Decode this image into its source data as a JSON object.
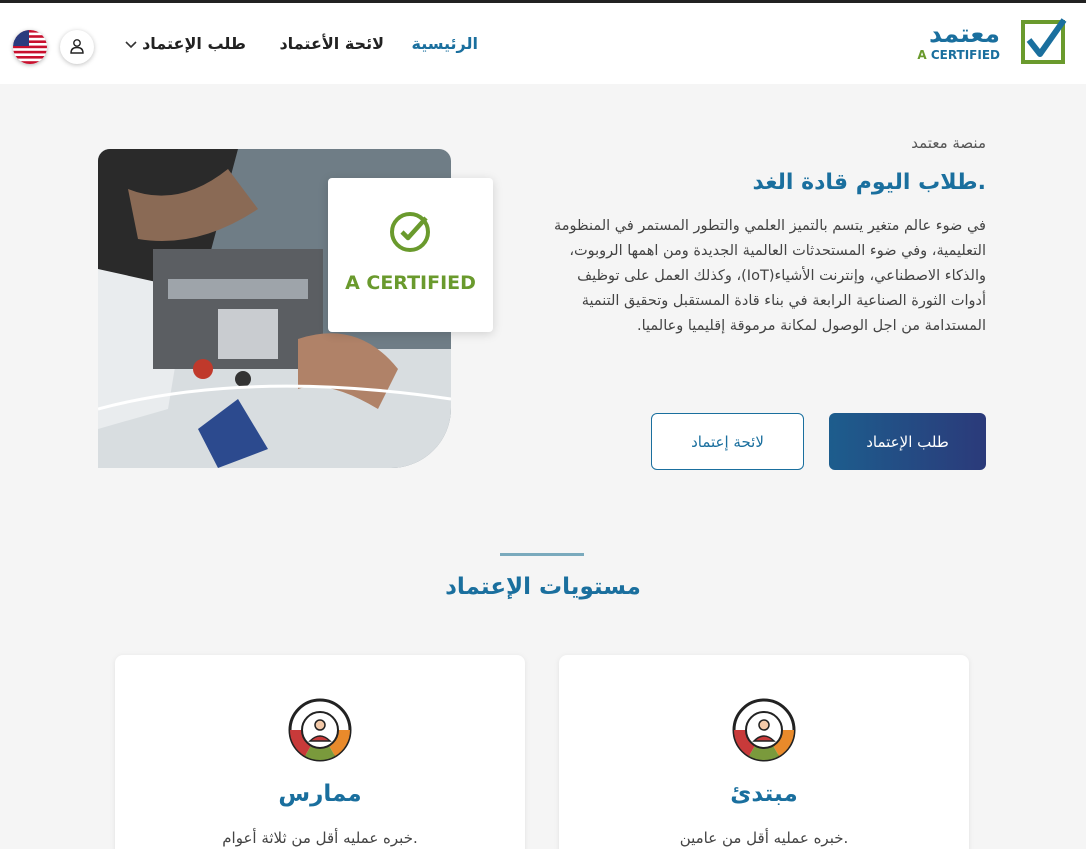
{
  "brand": {
    "logo_arabic": "معتمد",
    "logo_a": "A",
    "logo_certified": "CERTIFIED"
  },
  "nav": {
    "home": "الرئيسية",
    "list": "لائحة الأعتماد",
    "apply": "طلب الإعتماد"
  },
  "hero": {
    "platform": "منصة معتمد",
    "title": "طلاب اليوم قادة الغد.",
    "description": "في ضوء عالم متغير يتسم بالتميز العلمي والتطور المستمر في المنظومة التعليمية، وفي ضوء المستحدثات العالمية الجديدة ومن اهمها الروبوت، والذكاء الاصطناعي، وإنترنت الأشياء(IoT)، وكذلك العمل على توظيف أدوات الثورة الصناعية الرابعة في بناء قادة المستقبل وتحقيق التنمية المستدامة من اجل الوصول لمكانة مرموقة إقليميا وعالميا.",
    "primary_button": "طلب الإعتماد",
    "secondary_button": "لائحة إعتماد",
    "cert_badge_text": "A CERTIFIED"
  },
  "levels": {
    "title": "مستويات الإعتماد",
    "cards": [
      {
        "title": "ممارس",
        "desc": "خبره عمليه أقل من ثلاثة أعوام."
      },
      {
        "title": "مبتدئ",
        "desc": "خبره عمليه أقل من عامين."
      }
    ]
  },
  "colors": {
    "primary": "#1a6f9e",
    "accent_green": "#6a9a2d",
    "button_gradient_start": "#1d5d8d",
    "button_gradient_end": "#2b3a7a"
  },
  "icons": [
    "chevron-down-icon",
    "user-icon",
    "us-flag-icon",
    "checkmark-icon",
    "level-wheel-icon"
  ]
}
